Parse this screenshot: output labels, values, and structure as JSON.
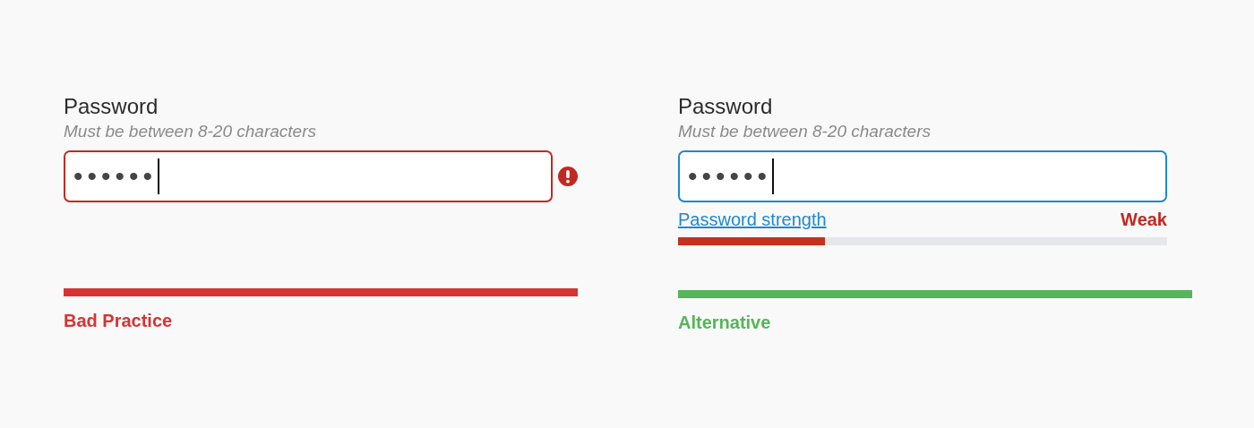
{
  "panels": [
    {
      "label": "Password",
      "hint": "Must be between 8-20 characters",
      "field": {
        "value": "••••••",
        "invalid": true
      },
      "verdict": {
        "text": "Bad Practice",
        "color": "#d63333"
      }
    },
    {
      "label": "Password",
      "hint": "Must be between 8-20 characters",
      "field": {
        "value": "••••••",
        "invalid": false
      },
      "strength": {
        "link": "Password strength",
        "reading": "Weak",
        "level": 0.3
      },
      "verdict": {
        "text": "Alternative",
        "color": "#55b55a"
      }
    }
  ]
}
